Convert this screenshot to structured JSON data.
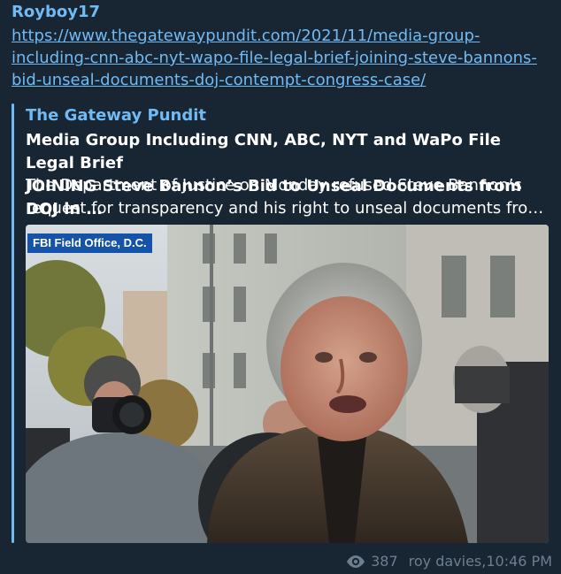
{
  "message": {
    "sender": "Royboy17",
    "link_text": "https://www.thegatewaypundit.com/2021/11/media-group-\nincluding-cnn-abc-nyt-wapo-file-legal-brief-joining-steve-bannons-\nbid-unseal-documents-doj-contempt-congress-case/",
    "preview": {
      "site_name": "The Gateway Pundit",
      "title": "Media Group Including CNN, ABC, NYT and WaPo File Legal Brief\nJOINING Steve Bannon’s Bid to Unseal Documents from DOJ in …",
      "description": "The Department of Justice on Monday refused Steve Bannon’s\nrequest for transparency and his right to unseal documents fro…",
      "image_overlay": "FBI Field Office, D.C."
    },
    "views": "387",
    "author": "roy davies",
    "time": "10:46 PM"
  },
  "colors": {
    "background": "#17212b",
    "bubble": "#182533",
    "accent": "#71baf2",
    "meta": "#6d7f8f",
    "overlay_label": "#1553a8"
  },
  "icons": {
    "views": "eye-icon"
  }
}
